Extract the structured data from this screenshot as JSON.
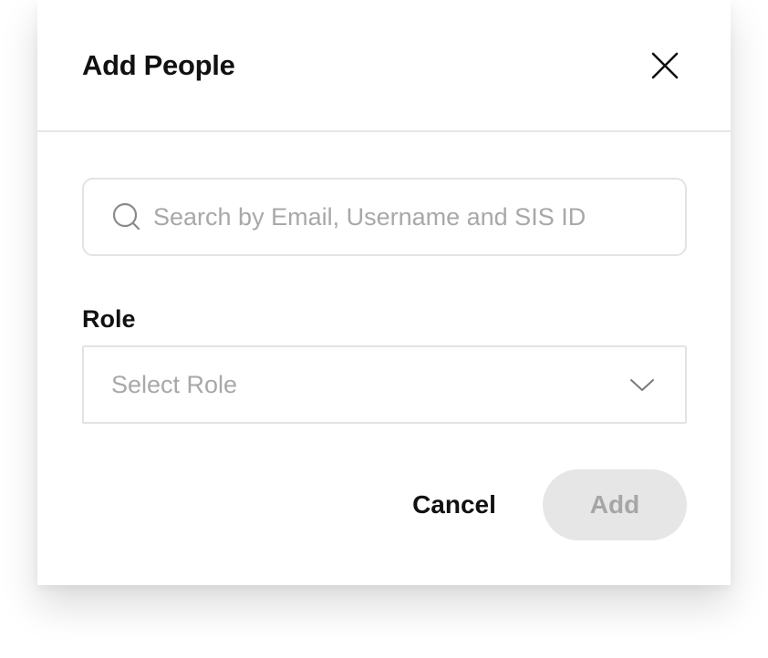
{
  "dialog": {
    "title": "Add People",
    "close_icon": "close-icon"
  },
  "search": {
    "placeholder": "Search by Email, Username and SIS ID",
    "value": "",
    "icon": "search-icon"
  },
  "role": {
    "label": "Role",
    "selected": "Select Role",
    "icon": "chevron-down-icon"
  },
  "actions": {
    "cancel_label": "Cancel",
    "add_label": "Add",
    "add_enabled": false
  },
  "colors": {
    "text": "#111111",
    "placeholder": "#a8a8a8",
    "border": "#e3e3e3",
    "disabled_bg": "#e6e6e6",
    "disabled_text": "#a6a6a6"
  }
}
